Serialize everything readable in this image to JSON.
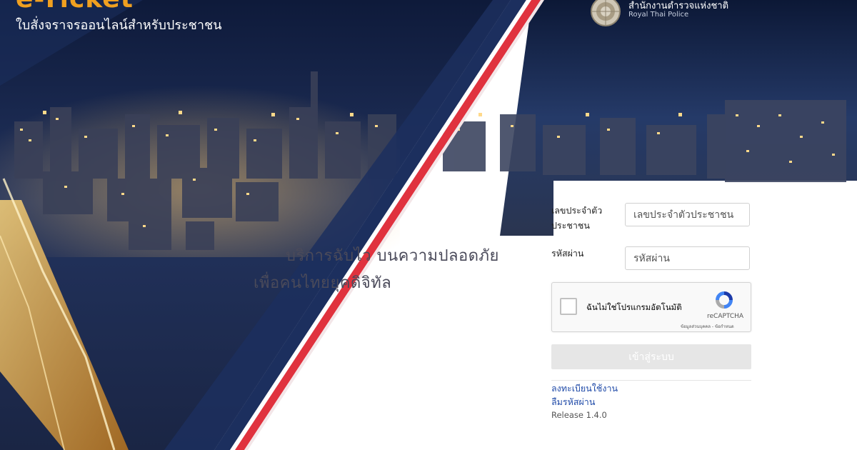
{
  "brand": {
    "title": "e-Ticket",
    "subtitle": "ใบสั่งจราจรออนไลน์สำหรับประชาชน"
  },
  "agency": {
    "name_th": "สำนักงานตำรวจแห่งชาติ",
    "name_en": "Royal Thai Police",
    "logo_icon": "police-emblem-icon"
  },
  "slogan": {
    "line1": "บริการฉับไว บนความปลอดภัย",
    "line2": "เพื่อคนไทยยุคดิจิทัล"
  },
  "login_form": {
    "id_label": "เลขประจำตัวประชาชน",
    "id_placeholder": "เลขประจำตัวประชาชน",
    "password_label": "รหัสผ่าน",
    "password_placeholder": "รหัสผ่าน",
    "captcha": {
      "label": "ฉันไม่ใช่โปรแกรมอัตโนมัติ",
      "brand": "reCAPTCHA",
      "terms": "ข้อมูลส่วนบุคคล - ข้อกำหนด"
    },
    "login_button": "เข้าสู่ระบบ",
    "register_link": "ลงทะเบียนใช้งาน",
    "forgot_link": "ลืมรหัสผ่าน",
    "release": "Release 1.4.0"
  },
  "colors": {
    "navy": "#1c2f5e",
    "flag_red": "#e0323e",
    "brand_orange": "#f0a020",
    "link_blue": "#1f4aa8",
    "button_disabled": "#e6e6e6"
  }
}
